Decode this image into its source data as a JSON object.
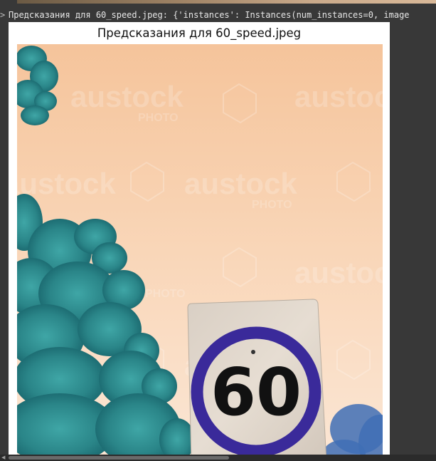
{
  "output": {
    "prompt_mark": ">",
    "log_line": "Предсказания для 60_speed.jpeg: {'instances': Instances(num_instances=0, image"
  },
  "figure": {
    "title": "Предсказания для 60_speed.jpeg",
    "watermark_text": "austock",
    "watermark_subtext": "PHOTO",
    "sign_number": "60"
  },
  "icons": {
    "scroll_left": "triangle-left-icon"
  },
  "colors": {
    "background": "#383838",
    "sign_ring": "#3a2a9a",
    "foliage": "#2f8c8e",
    "sky_top": "#f6c9a1",
    "sky_bottom": "#fbe3cf"
  },
  "scrollbar": {
    "position_fraction": 0.0,
    "visible_fraction": 0.5
  }
}
